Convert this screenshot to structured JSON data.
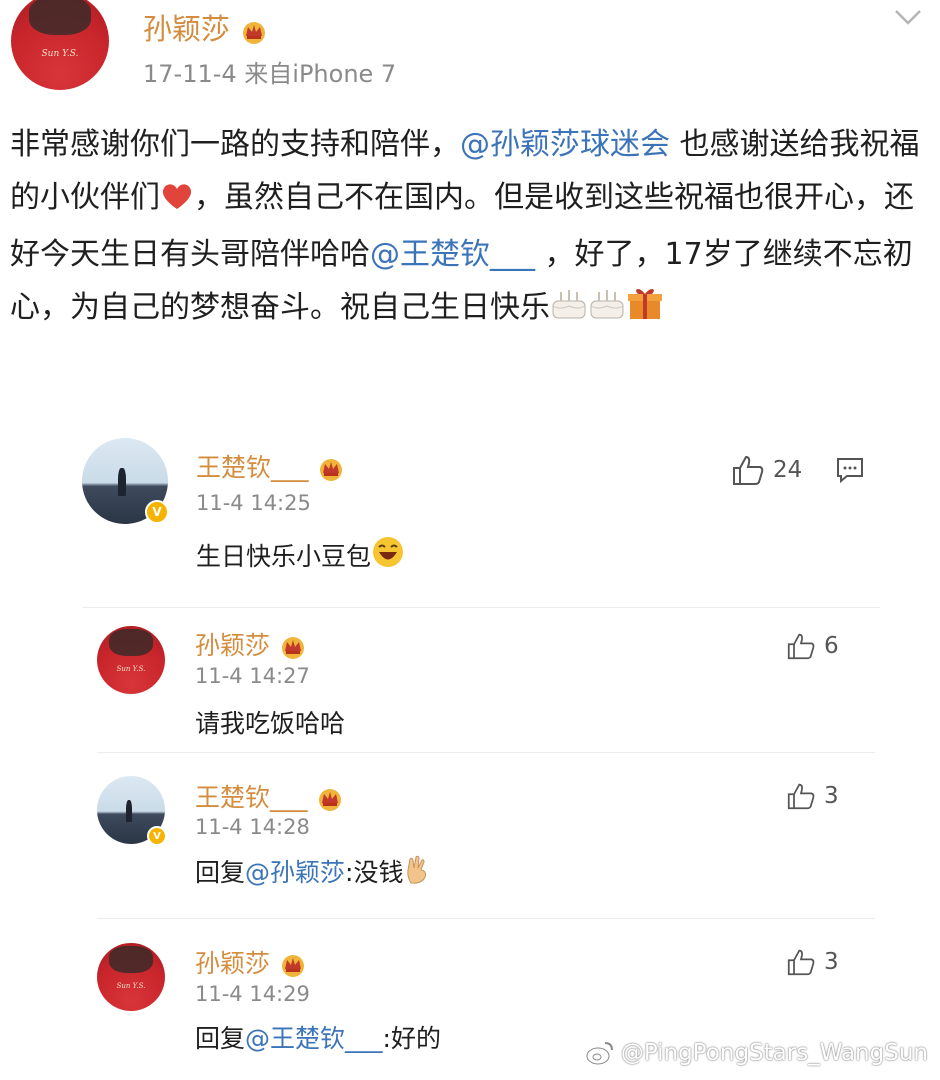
{
  "post": {
    "author": "孙颖莎",
    "meta": "17-11-4  来自iPhone 7",
    "text_before": "非常感谢你们一路的支持和陪伴，",
    "mention1": "@孙颖莎球迷会",
    "text_mid1": " 也感谢送给我祝福的小伙伴们",
    "text_mid2": "，虽然自己不在国内。但是收到这些祝福也很开心，还好今天生日有头哥陪伴哈哈",
    "mention2": "@王楚钦___",
    "text_after": " ，好了，17岁了继续不忘初心，为自己的梦想奋斗。祝自己生日快乐"
  },
  "comments": [
    {
      "author": "王楚钦___",
      "time": "11-4 14:25",
      "text": "生日快乐小豆包",
      "likes": "24"
    },
    {
      "author": "孙颖莎",
      "time": "11-4 14:27",
      "text": "请我吃饭哈哈",
      "likes": "6"
    },
    {
      "author": "王楚钦___",
      "time": "11-4 14:28",
      "reply_prefix": "回复",
      "reply_mention": "@孙颖莎",
      "text": ":没钱",
      "likes": "3"
    },
    {
      "author": "孙颖莎",
      "time": "11-4 14:29",
      "reply_prefix": "回复",
      "reply_mention": "@王楚钦___",
      "text": ":好的",
      "likes": "3"
    }
  ],
  "avatar_tag": "Sun Y.S.",
  "watermark": "@PingPongStars_WangSun",
  "colors": {
    "name": "#d48c3f",
    "mention": "#3b74b8",
    "meta": "#8a8a8a"
  },
  "icons": [
    "crown-badge-icon",
    "chevron-down-icon",
    "thumbs-up-icon",
    "comment-icon",
    "heart-icon",
    "cake-icon",
    "gift-icon",
    "laugh-icon",
    "hand-gesture-icon",
    "weibo-logo-icon",
    "verified-v-icon"
  ]
}
